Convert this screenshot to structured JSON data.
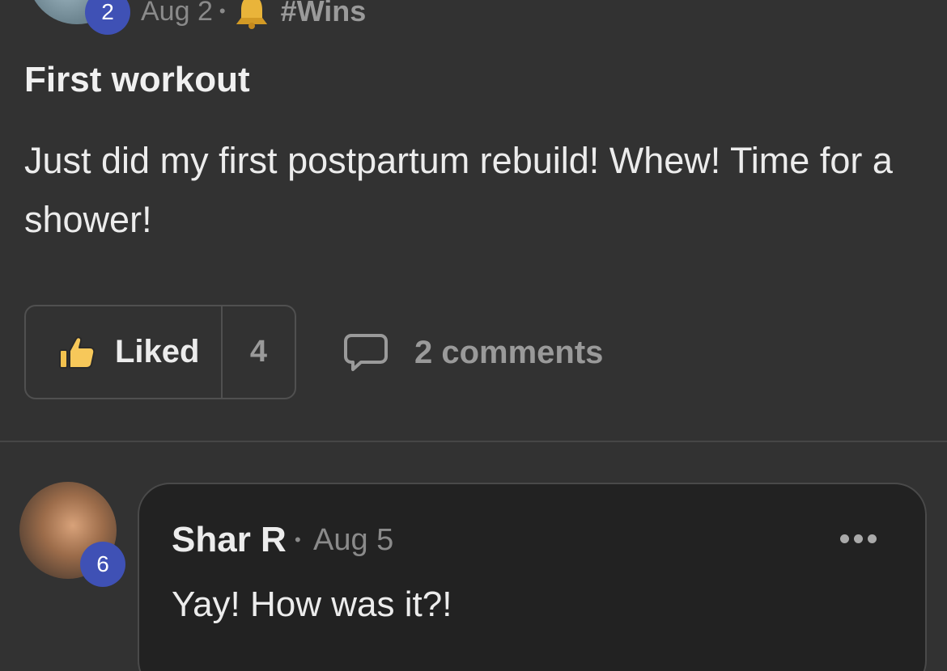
{
  "post": {
    "author_level": "2",
    "date": "Aug 2",
    "separator": "•",
    "category": "#Wins",
    "title": "First workout",
    "body": "Just did my first postpartum rebuild! Whew! Time for a shower!"
  },
  "actions": {
    "like_label": "Liked",
    "like_count": "4",
    "comments_label": "2 comments"
  },
  "comment": {
    "author": "Shar R",
    "separator": "•",
    "date": "Aug 5",
    "author_level": "6",
    "text": "Yay! How was it?!"
  },
  "colors": {
    "background": "#323232",
    "card": "#222222",
    "level_badge": "#3f51b5",
    "muted_text": "#8a8a8a"
  },
  "icons": [
    "bell-icon",
    "thumbs-up-icon",
    "comment-bubble-icon",
    "more-options-icon"
  ]
}
